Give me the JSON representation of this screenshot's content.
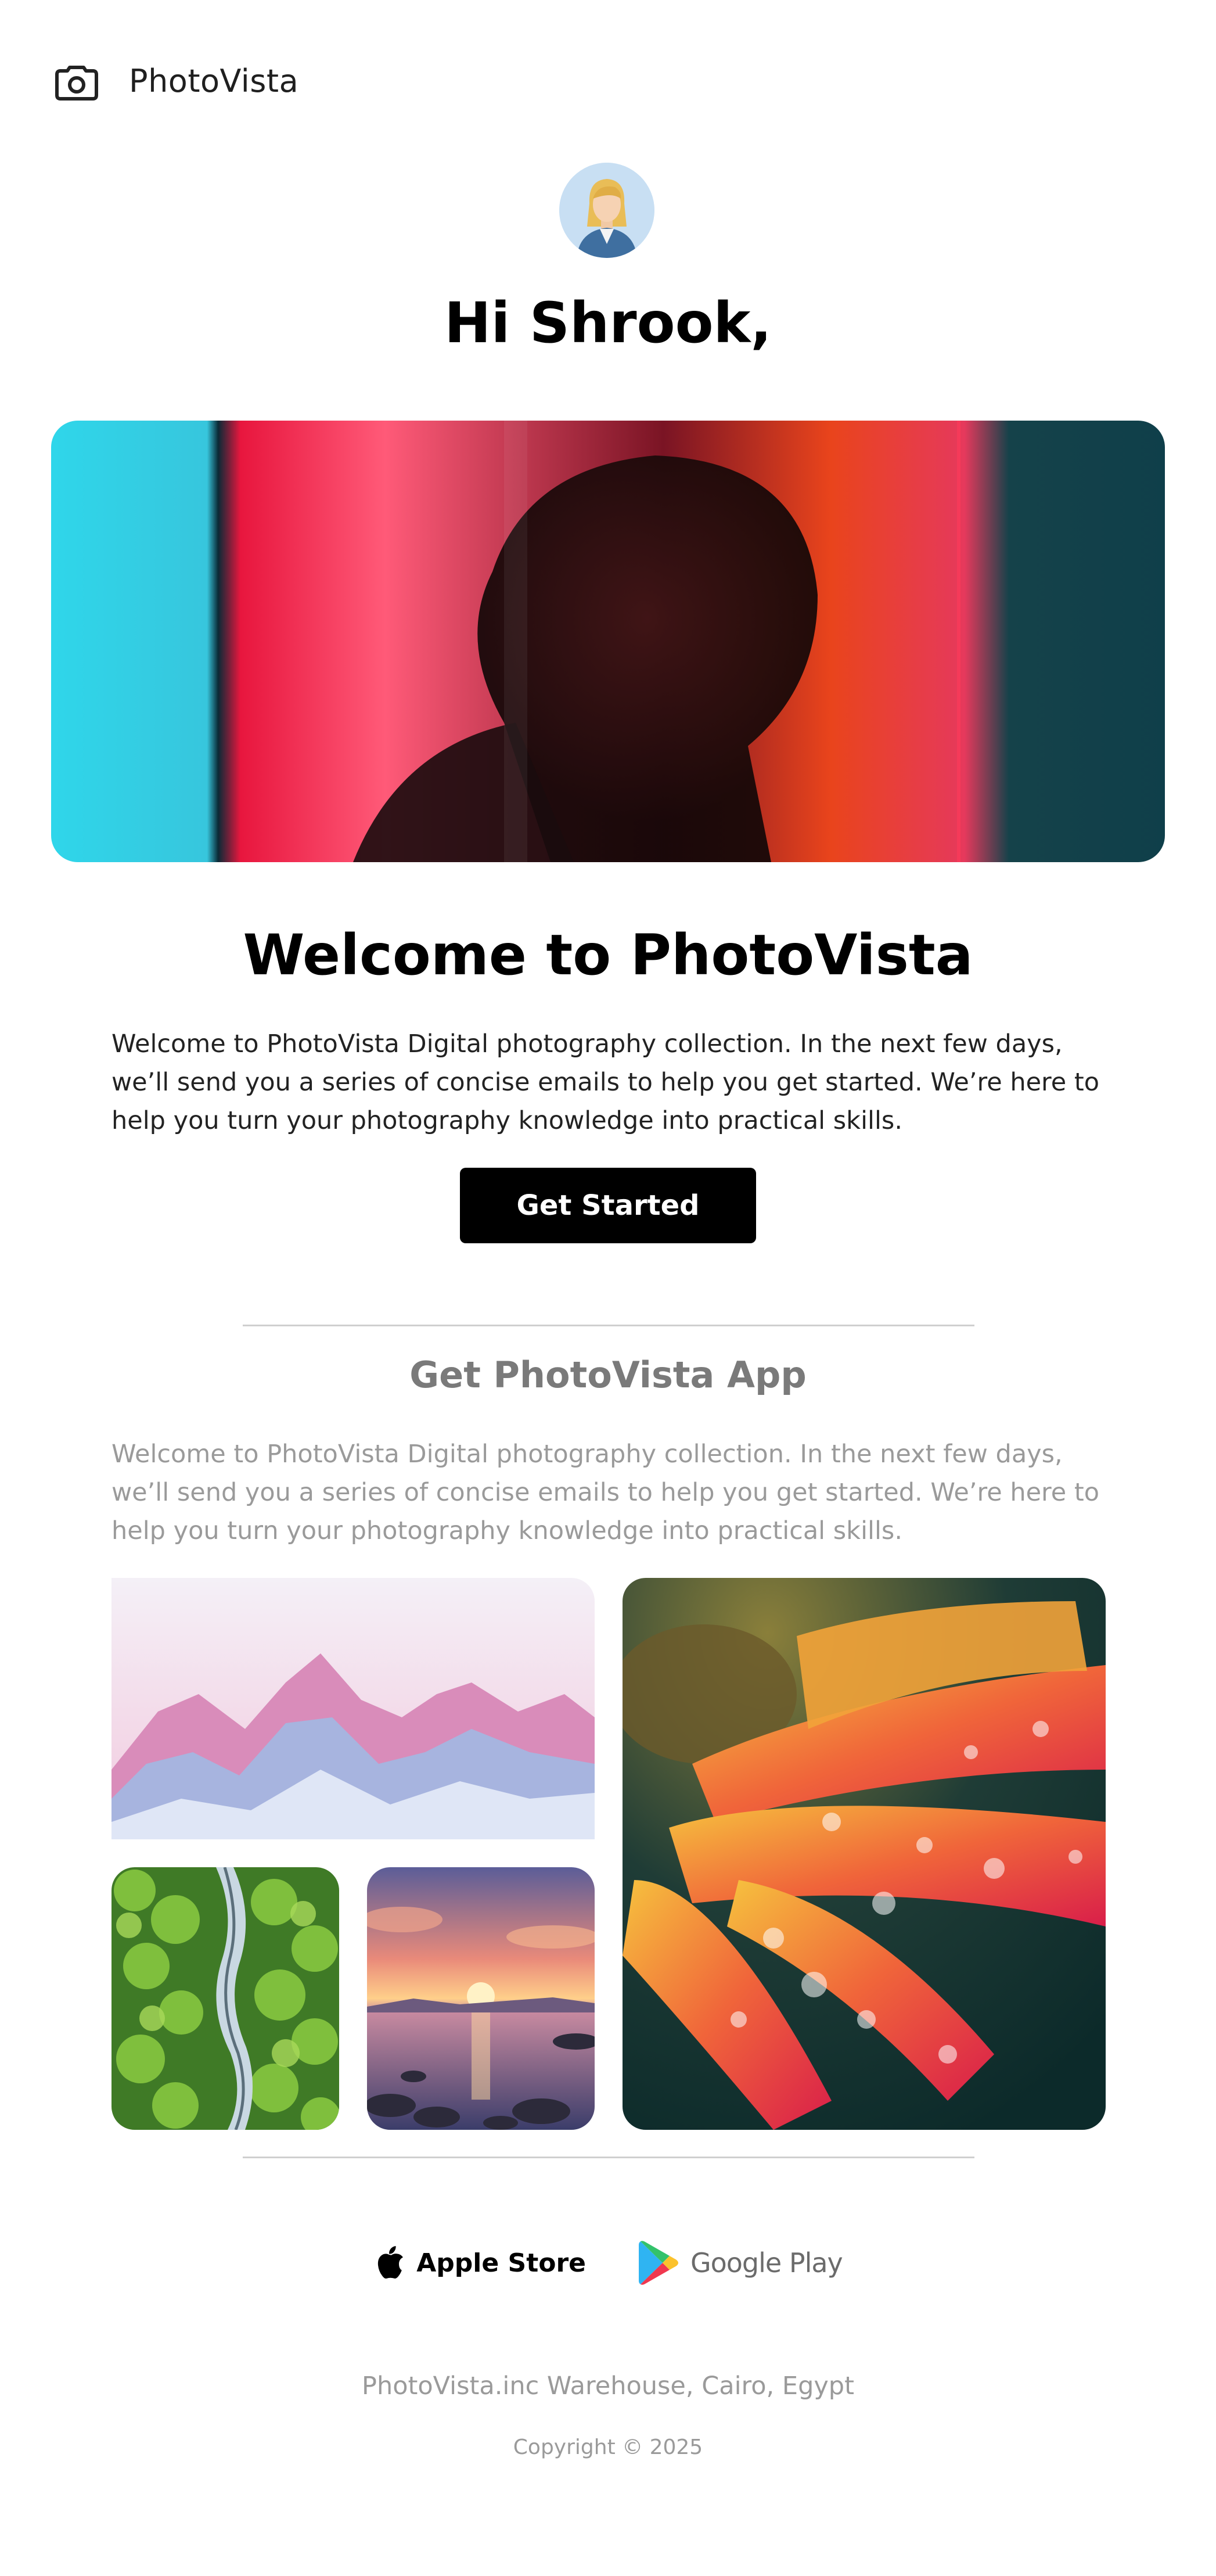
{
  "header": {
    "brand": "PhotoVista",
    "logo_icon": "camera-icon"
  },
  "greeting": "Hi Shrook,",
  "hero": {
    "alt": ""
  },
  "welcome": {
    "title": "Welcome to PhotoVista",
    "text": "Welcome to PhotoVista Digital photography collection. In the next few days, we’ll send you a series of concise emails to help you get started. We’re here to help you turn your photography knowledge into practical skills.",
    "cta_label": "Get Started"
  },
  "app": {
    "title": "Get PhotoVista App",
    "text": "Welcome to PhotoVista Digital photography collection. In the next few days, we’ll send you a series of concise emails to help you get started. We’re here to help you turn your photography knowledge into practical skills."
  },
  "stores": {
    "apple": "Apple Store",
    "google": "Google Play"
  },
  "footer": {
    "address": "PhotoVista.inc Warehouse, Cairo, Egypt",
    "copyright": "Copyright © 2025"
  },
  "colors": {
    "accent": "#000000",
    "muted": "#9a9a9a",
    "divider": "#cfcfcf"
  }
}
